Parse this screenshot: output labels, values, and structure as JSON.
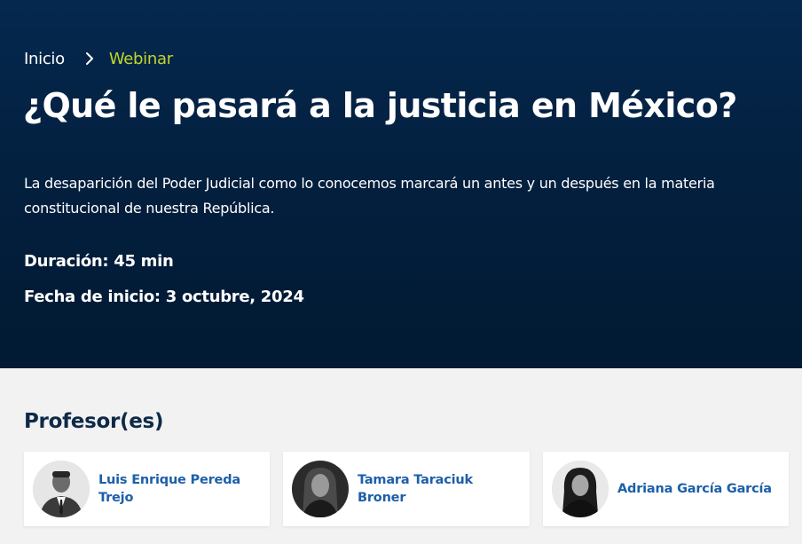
{
  "breadcrumb": {
    "home": "Inicio",
    "current": "Webinar"
  },
  "title": "¿Qué le pasará a la justicia en México?",
  "description": "La desaparición del Poder Judicial como lo conocemos marcará un antes y un después en la materia constitucional  de nuestra República.",
  "meta": {
    "duration": "Duración: 45 min",
    "start_date": "Fecha de inicio: 3 octubre, 2024"
  },
  "professors_section": {
    "title": "Profesor(es)",
    "professors": [
      {
        "name": "Luis Enrique Pereda Trejo"
      },
      {
        "name": "Tamara Taraciuk Broner"
      },
      {
        "name": "Adriana García García"
      }
    ]
  },
  "colors": {
    "hero_bg": "#03213f",
    "breadcrumb_accent": "#c3d52b",
    "section_title": "#0e2a47",
    "professor_name": "#1d5fa8",
    "page_bg": "#f2f2f2"
  },
  "icons": {
    "breadcrumb_separator": "chevron-right-icon"
  }
}
